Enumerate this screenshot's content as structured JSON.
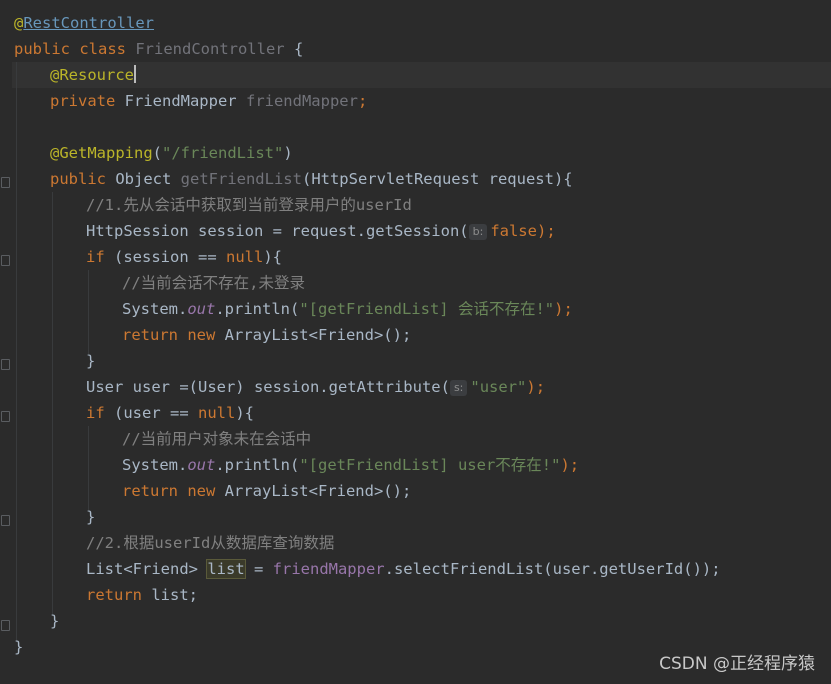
{
  "code": {
    "l1_at": "@",
    "l1_ann": "RestController",
    "l2_kw": "public class ",
    "l2_name": "FriendController",
    "l2_rest": " {",
    "l3_ann": "@Resource",
    "l4_kw": "private ",
    "l4_type": "FriendMapper ",
    "l4_field": "friendMapper",
    "l4_semi": ";",
    "l6_ann": "@GetMapping",
    "l6_p1": "(",
    "l6_str": "\"/friendList\"",
    "l6_p2": ")",
    "l7_kw": "public ",
    "l7_type": "Object ",
    "l7_method": "getFriendList",
    "l7_rest": "(HttpServletRequest request){",
    "l8_cmt": "//1.先从会话中获取到当前登录用户的userId",
    "l9_a": "HttpSession session = request.getSession(",
    "l9_hint": "b:",
    "l9_kw": "false",
    "l9_end": ");",
    "l10_kw": "if ",
    "l10_a": "(session == ",
    "l10_null": "null",
    "l10_b": "){",
    "l11_cmt": "//当前会话不存在,未登录",
    "l12_a": "System.",
    "l12_out": "out",
    "l12_b": ".println(",
    "l12_str": "\"[getFriendList] 会话不存在!\"",
    "l12_end": ");",
    "l13_kw": "return new ",
    "l13_a": "ArrayList<Friend>();",
    "l14": "}",
    "l15_a": "User user =(User) session.getAttribute(",
    "l15_hint": "s:",
    "l15_str": "\"user\"",
    "l15_end": ");",
    "l16_kw": "if ",
    "l16_a": "(user == ",
    "l16_null": "null",
    "l16_b": "){",
    "l17_cmt": "//当前用户对象未在会话中",
    "l18_a": "System.",
    "l18_out": "out",
    "l18_b": ".println(",
    "l18_str": "\"[getFriendList] user不存在!\"",
    "l18_end": ");",
    "l19_kw": "return new ",
    "l19_a": "ArrayList<Friend>();",
    "l20": "}",
    "l21_cmt": "//2.根据userId从数据库查询数据",
    "l22_a": "List<Friend> ",
    "l22_sel": "list",
    "l22_b": " = ",
    "l22_field": "friendMapper",
    "l22_c": ".selectFriendList(user.getUserId());",
    "l23_kw": "return ",
    "l23_a": "list;",
    "l24": "}",
    "l25": "}"
  },
  "watermark": "CSDN @正经程序猿",
  "colors": {
    "background": "#2b2b2b",
    "keyword": "#cc7832",
    "annotation": "#bbb529",
    "string": "#6a8759",
    "comment": "#808080",
    "field": "#9876aa",
    "method": "#ffc66d"
  }
}
